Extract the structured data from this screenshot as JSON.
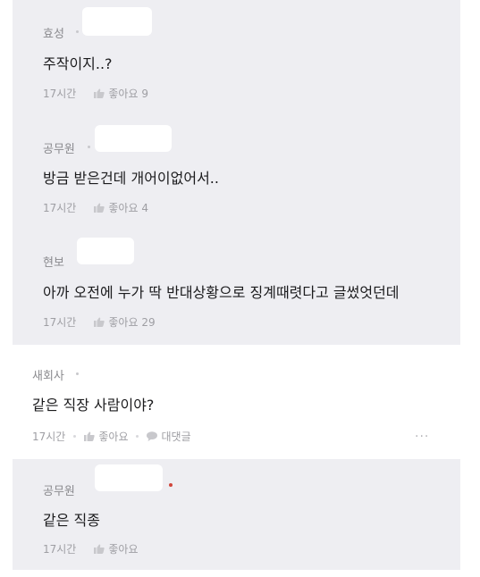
{
  "comments": [
    {
      "author": "효성",
      "text": "주작이지..?",
      "time": "17시간",
      "like_label": "좋아요",
      "like_count": "9"
    },
    {
      "author": "공무원",
      "text": "방금 받은건데 개어이없어서..",
      "time": "17시간",
      "like_label": "좋아요",
      "like_count": "4"
    },
    {
      "author": "현보",
      "text": "아까 오전에 누가 딱 반대상황으로 징계때렷다고 글썼엇던데",
      "time": "17시간",
      "like_label": "좋아요",
      "like_count": "29"
    },
    {
      "author": "새회사",
      "text": "같은 직장 사람이야?",
      "time": "17시간",
      "like_label": "좋아요",
      "reply_label": "대댓글",
      "more": "···"
    },
    {
      "author": "공무원",
      "text": "같은 직종",
      "time": "17시간",
      "like_label": "좋아요"
    }
  ],
  "colors": {
    "reply_bg": "#eeeef2",
    "text": "#1b1b1d",
    "meta": "#9e9ea3",
    "mark": "#d0453a"
  }
}
